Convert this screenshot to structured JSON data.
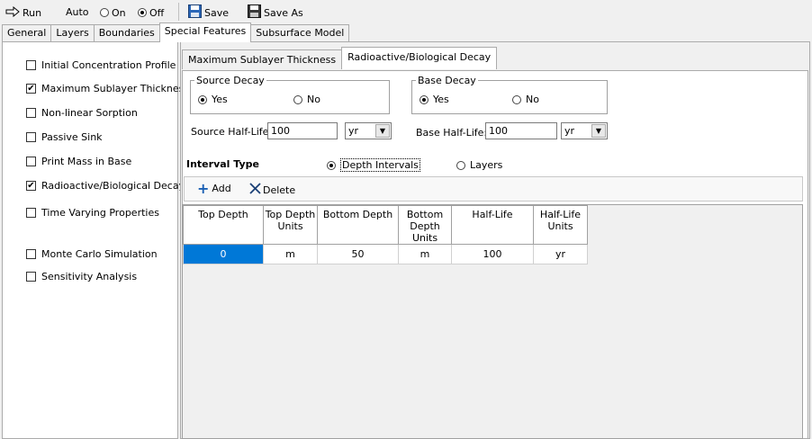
{
  "toolbar": {
    "run": "Run",
    "auto": "Auto",
    "on": "On",
    "off": "Off",
    "save": "Save",
    "save_as": "Save As"
  },
  "main_tabs": [
    "General",
    "Layers",
    "Boundaries",
    "Special Features",
    "Subsurface Model"
  ],
  "features": [
    {
      "label": "Initial Concentration Profile",
      "checked": false
    },
    {
      "label": "Maximum Sublayer Thickness",
      "checked": true
    },
    {
      "label": "Non-linear Sorption",
      "checked": false
    },
    {
      "label": "Passive Sink",
      "checked": false
    },
    {
      "label": "Print Mass in Base",
      "checked": false
    },
    {
      "label": "Radioactive/Biological Decay",
      "checked": true
    },
    {
      "label": "Time Varying Properties",
      "checked": false
    },
    {
      "label": "Monte Carlo Simulation",
      "checked": false
    },
    {
      "label": "Sensitivity Analysis",
      "checked": false
    }
  ],
  "sub_tabs": [
    "Maximum Sublayer Thickness",
    "Radioactive/Biological Decay"
  ],
  "source_decay": {
    "title": "Source Decay",
    "yes": "Yes",
    "no": "No"
  },
  "base_decay": {
    "title": "Base Decay",
    "yes": "Yes",
    "no": "No"
  },
  "source_half_life": {
    "label": "Source Half-Life:",
    "value": "100",
    "unit": "yr"
  },
  "base_half_life": {
    "label": "Base Half-Life:",
    "value": "100",
    "unit": "yr"
  },
  "interval_type": {
    "label": "Interval Type",
    "depth": "Depth Intervals",
    "layers": "Layers"
  },
  "grid_toolbar": {
    "add": "Add",
    "delete": "Delete"
  },
  "table": {
    "headers": [
      "Top Depth",
      "Top Depth Units",
      "Bottom Depth",
      "Bottom Depth Units",
      "Half-Life",
      "Half-Life Units"
    ],
    "rows": [
      [
        "0",
        "m",
        "50",
        "m",
        "100",
        "yr"
      ]
    ]
  }
}
